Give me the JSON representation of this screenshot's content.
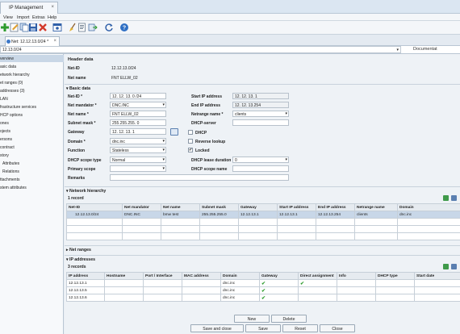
{
  "window": {
    "title": "IP Management",
    "close": "×"
  },
  "menu": [
    "View",
    "Import",
    "Extras",
    "Help"
  ],
  "doc_tab": {
    "label": "Net: 12.12.13.0/24 *",
    "close": "×"
  },
  "address_bar": {
    "value": "12.13.0/24",
    "right_label": "Documentat"
  },
  "sidebar": {
    "items": [
      "verview",
      "asic data",
      "etwork hierarchy",
      "et ranges (0)",
      "addresses (3)",
      "LAN",
      "frastructure services",
      "HCP options",
      "ones",
      "ojects",
      "ersons",
      "contract",
      "story",
      "Attributes",
      "Relations",
      "ttachments",
      "stem attributes"
    ],
    "selected": 0
  },
  "header": {
    "title": "Header data",
    "net_id_label": "Net-ID",
    "net_id_value": "12.12.13.0/24",
    "net_name_label": "Net name",
    "net_name_value": "FNT ELLW_02"
  },
  "basic": {
    "title": "Basic data",
    "net_id_label": "Net-ID *",
    "net_id_value": "12. 12. 13.  0 /24",
    "mandator_label": "Net mandator *",
    "mandator_value": "DNC.INC",
    "net_name_label": "Net name *",
    "net_name_value": "FNT ELLW_02",
    "subnet_label": "Subnet mask *",
    "subnet_value": "255.255.255.  0",
    "gateway_label": "Gateway",
    "gateway_value": "12. 12. 13.  1",
    "domain_label": "Domain *",
    "domain_value": "dnc.inc",
    "function_label": "Function",
    "function_value": "Stateless",
    "scope_type_label": "DHCP scope type",
    "scope_type_value": "Normal",
    "primary_scope_label": "Primary scope",
    "primary_scope_value": "",
    "remarks_label": "Remarks",
    "remarks_value": "",
    "start_ip_label": "Start IP address",
    "start_ip_value": "12. 12. 13.  1",
    "end_ip_label": "End IP address",
    "end_ip_value": "12. 12. 13.254",
    "netrange_label": "Netrange name *",
    "netrange_value": "clients",
    "dhcp_server_label": "DHCP-server",
    "dhcp_server_value": "",
    "dhcp_label": "DHCP",
    "reverse_label": "Reverse lookup",
    "locked_label": "Locked",
    "lease_label": "DHCP lease duration",
    "lease_value": "0",
    "scope_name_label": "DHCP scope name",
    "scope_name_value": ""
  },
  "network": {
    "title": "Network hierarchy",
    "count": "1 record",
    "columns": [
      "Net-ID",
      "Net mandator",
      "Net name",
      "Subnet mask",
      "Gateway",
      "Start IP address",
      "End IP address",
      "Netrange name",
      "Domain"
    ],
    "rows": [
      [
        "12.12.13.0/24",
        "DNC.INC",
        "bmw test",
        "255.255.255.0",
        "12.12.13.1",
        "12.12.13.1",
        "12.12.13.254",
        "clients",
        "dnc.inc"
      ]
    ]
  },
  "net_ranges": {
    "title": "Net ranges"
  },
  "ip": {
    "title": "IP addresses",
    "count": "3 records",
    "columns": [
      "IP address",
      "Hostname",
      "Port / Interface",
      "MAC address",
      "Domain",
      "Gateway",
      "Direct assignment",
      "Info",
      "DHCP type",
      "Start date"
    ],
    "rows": [
      [
        "12.12.13.1",
        "",
        "",
        "",
        "dnc.inc",
        "✔",
        "✔",
        "",
        "",
        ""
      ],
      [
        "12.12.13.5",
        "",
        "",
        "",
        "dnc.inc",
        "✔",
        "",
        "",
        "",
        ""
      ],
      [
        "12.12.13.6",
        "",
        "",
        "",
        "dnc.inc",
        "✔",
        "",
        "",
        "",
        ""
      ]
    ]
  },
  "buttons": {
    "new": "New",
    "delete": "Delete",
    "save_close": "Save and close",
    "save": "Save",
    "reset": "Reset",
    "close": "Close"
  },
  "colors": {
    "accent": "#3c78c8",
    "check": "#2e9b2e"
  }
}
